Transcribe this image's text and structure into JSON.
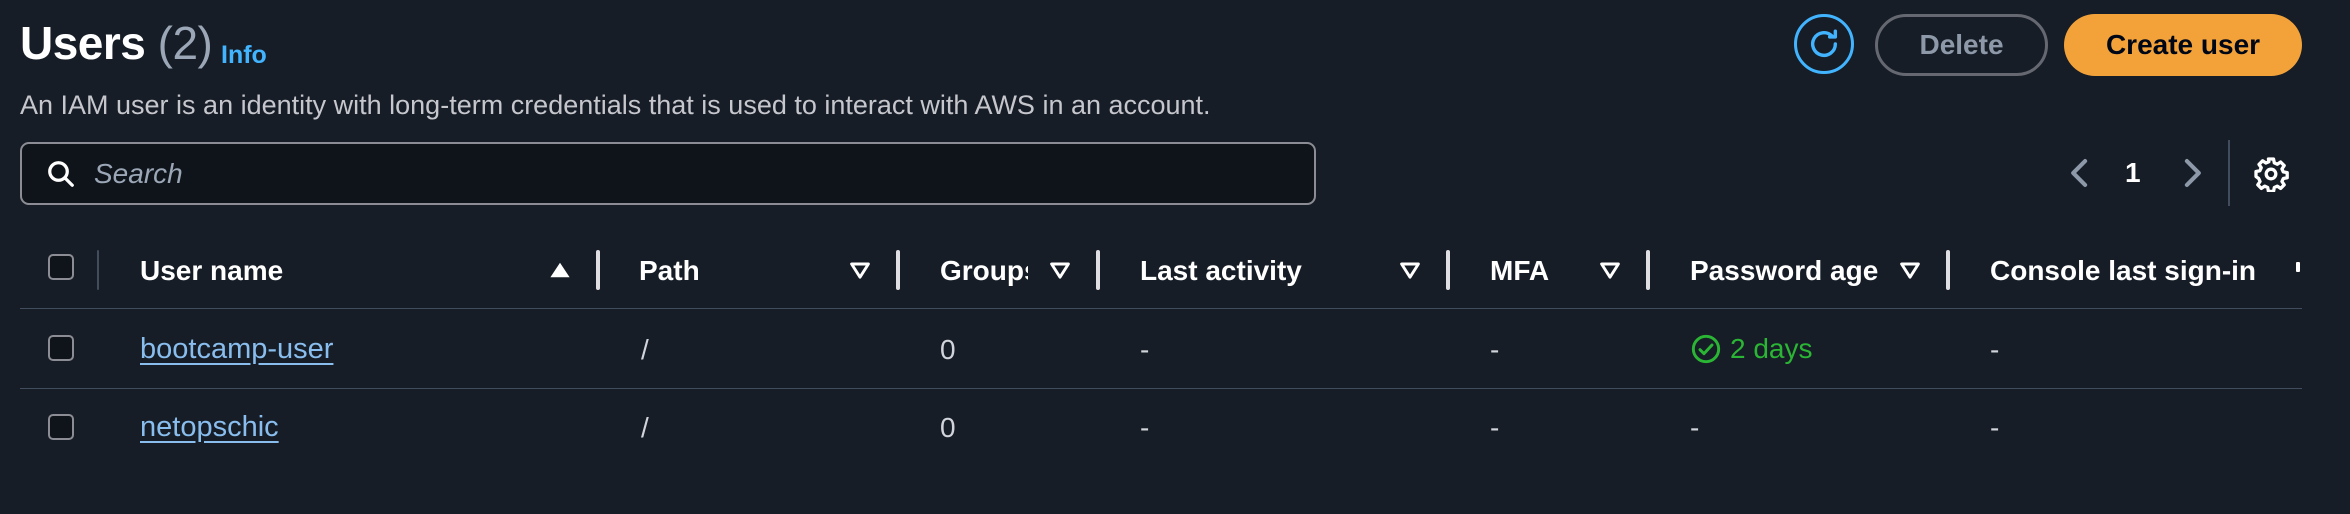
{
  "header": {
    "title": "Users",
    "count": "(2)",
    "info_link": "Info",
    "description": "An IAM user is an identity with long-term credentials that is used to interact with AWS in an account."
  },
  "actions": {
    "refresh_icon": "refresh-icon",
    "delete_label": "Delete",
    "create_label": "Create user"
  },
  "search": {
    "placeholder": "Search",
    "value": ""
  },
  "pagination": {
    "current_page": "1"
  },
  "table": {
    "columns": [
      {
        "label": "User name",
        "sort": "ascending"
      },
      {
        "label": "Path",
        "sort": "none"
      },
      {
        "label": "Groups",
        "sort": "none"
      },
      {
        "label": "Last activity",
        "sort": "none"
      },
      {
        "label": "MFA",
        "sort": "none"
      },
      {
        "label": "Password age",
        "sort": "none"
      },
      {
        "label": "Console last sign-in",
        "sort": "none"
      }
    ],
    "rows": [
      {
        "user_name": "bootcamp-user",
        "path": "/",
        "groups": "0",
        "last_activity": "-",
        "mfa": "-",
        "password_age": "2 days",
        "password_age_status": "ok",
        "console_last_sign_in": "-"
      },
      {
        "user_name": "netopschic",
        "path": "/",
        "groups": "0",
        "last_activity": "-",
        "mfa": "-",
        "password_age": "-",
        "password_age_status": "none",
        "console_last_sign_in": "-"
      }
    ]
  },
  "colors": {
    "background": "#161d26",
    "link": "#89bdee",
    "accent": "#42b4ff",
    "primary_button": "#f3a23a",
    "success": "#2bb534"
  }
}
